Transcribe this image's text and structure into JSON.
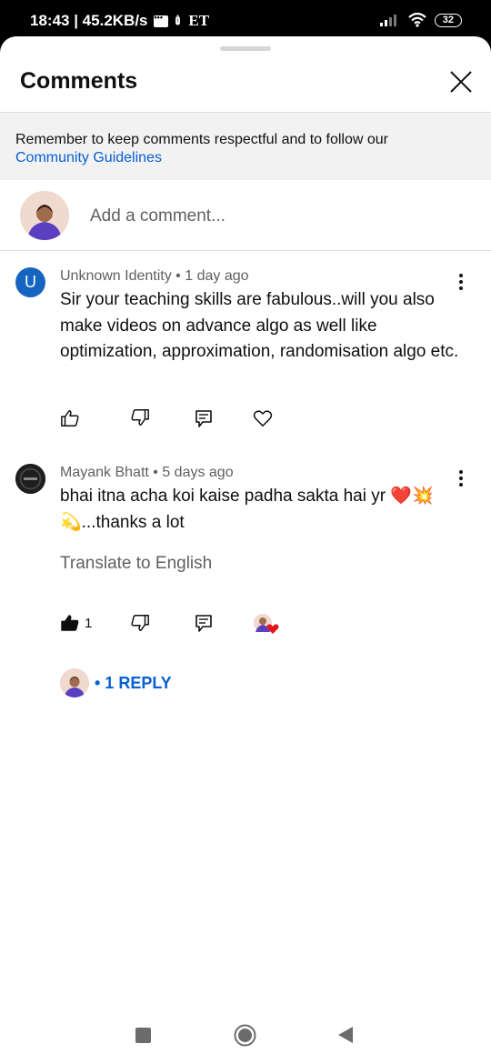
{
  "status_bar": {
    "time_speed": "18:43 | 45.2KB/s",
    "network_label": "ET",
    "battery": "32"
  },
  "sheet": {
    "title": "Comments",
    "notice_text": "Remember to keep comments respectful and to follow our",
    "notice_link": "Community Guidelines",
    "add_comment_placeholder": "Add a comment..."
  },
  "comments": [
    {
      "avatar_letter": "U",
      "meta": "Unknown Identity • 1 day ago",
      "text": "Sir your teaching skills are fabulous..will you also make videos on advance algo as well like optimization, approximation, randomisation algo etc."
    },
    {
      "meta": "Mayank Bhatt • 5 days ago",
      "text": "bhai itna acha koi kaise padha sakta hai yr ❤️💥💫...thanks a lot",
      "translate_label": "Translate to English",
      "like_count": "1",
      "reply_label": "• 1 REPLY"
    }
  ],
  "colors": {
    "accent_link": "#065fd4",
    "avatar_blue": "#1565c0",
    "heart_red": "#e3171c"
  },
  "icons": [
    "close-icon",
    "like-icon",
    "dislike-icon",
    "reply-icon",
    "heart-icon",
    "more-icon"
  ]
}
